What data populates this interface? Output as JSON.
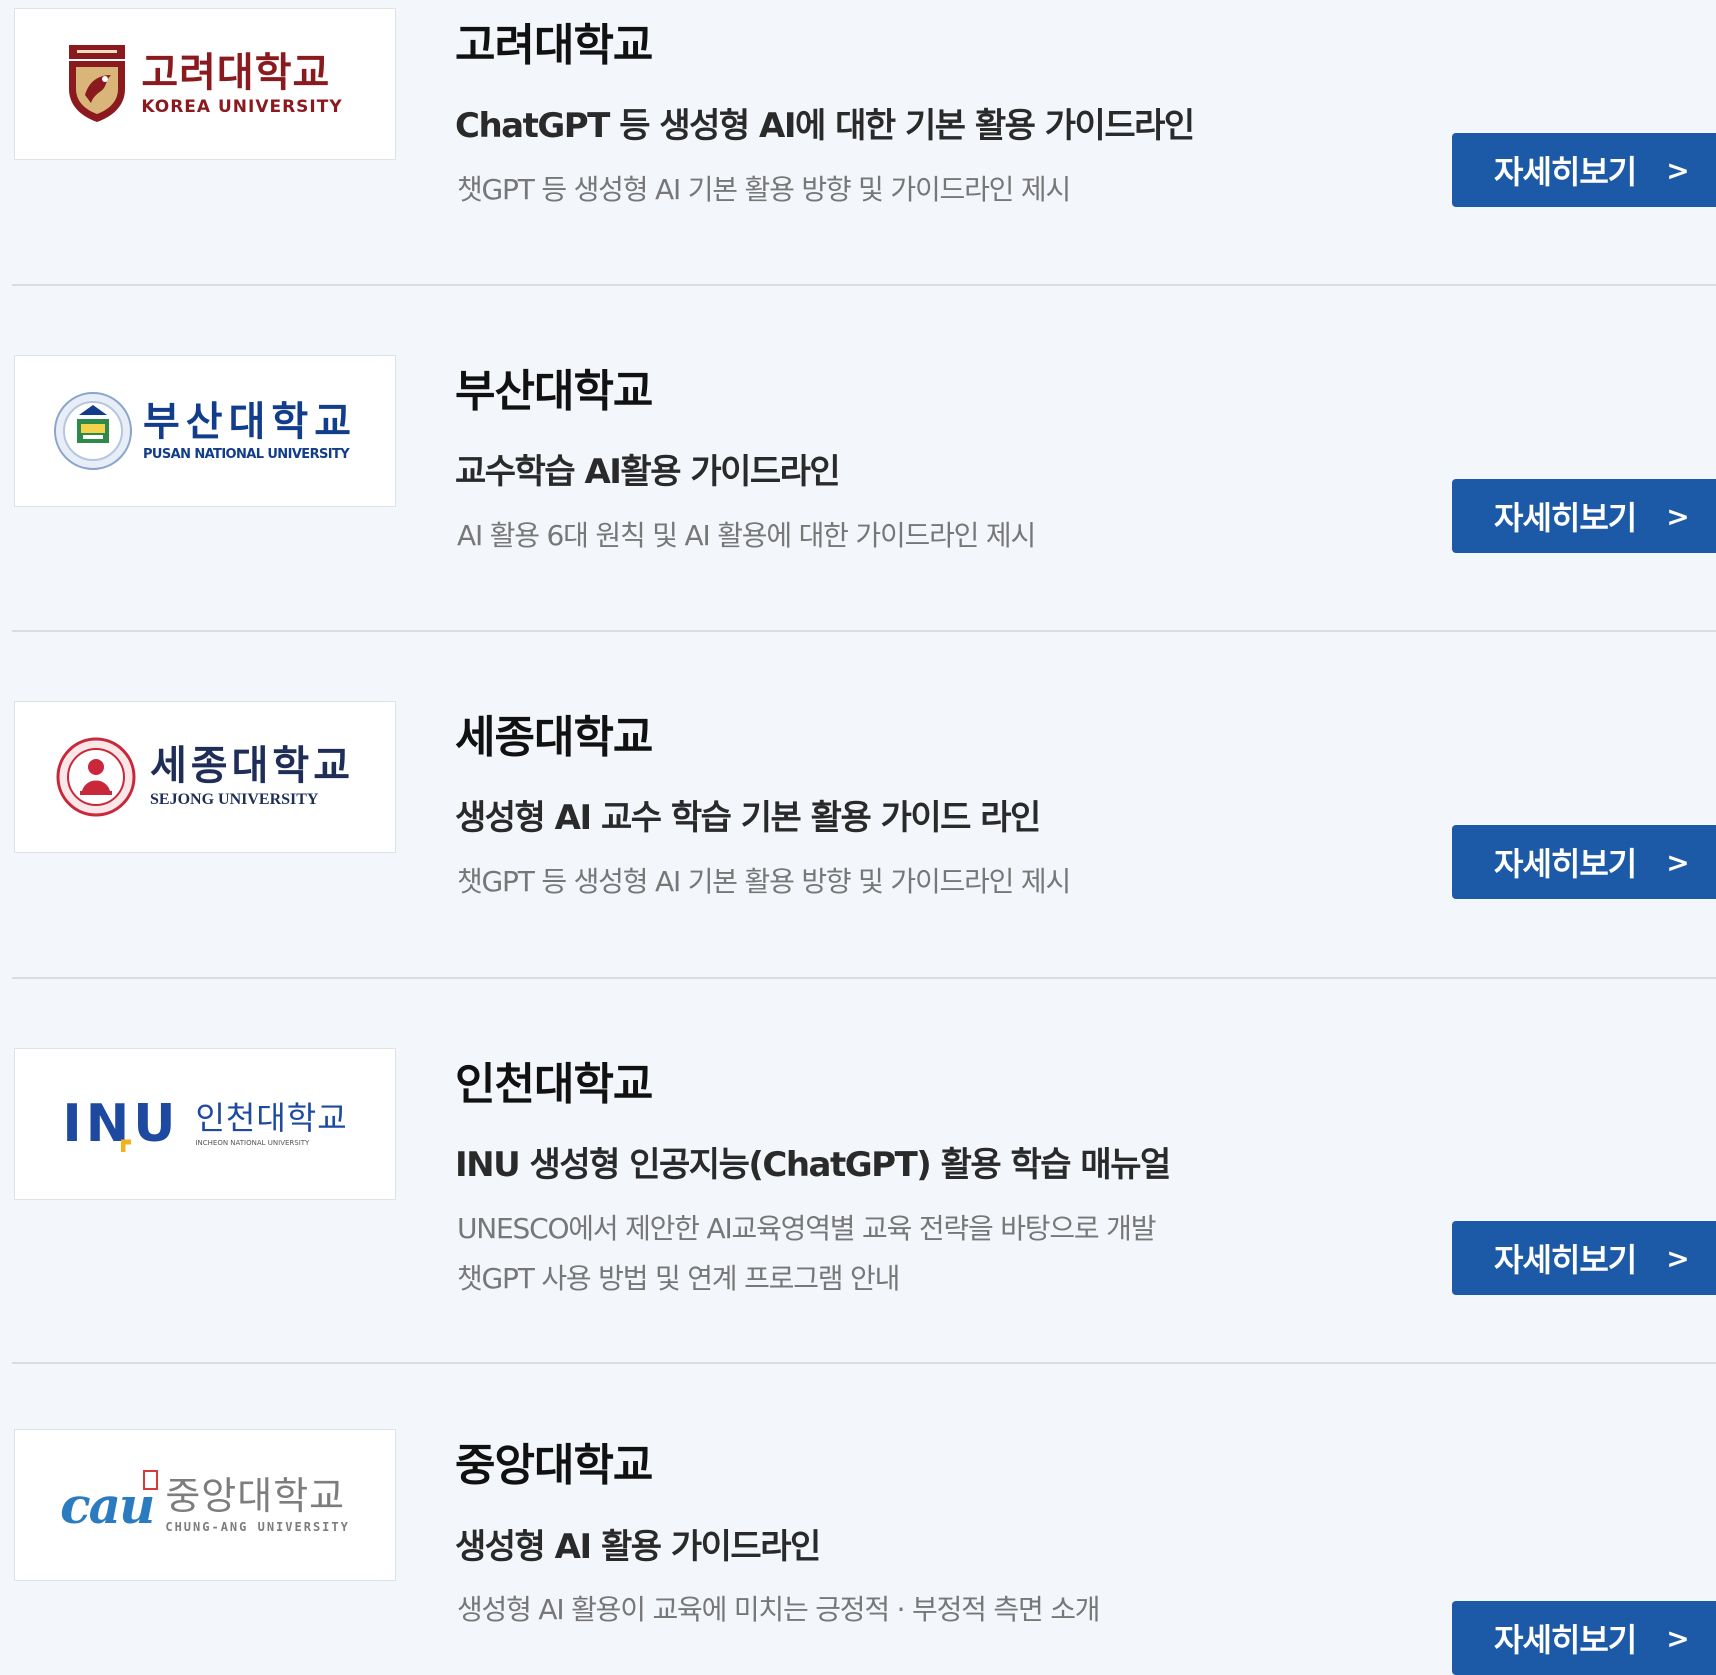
{
  "colors": {
    "background": "#f3f7fc",
    "button": "#1c5aa8",
    "korea_red": "#8b1a1f",
    "pusan_blue": "#123d8c",
    "sejong_red": "#c8283a",
    "inu_blue": "#1d4aa0",
    "inu_yellow": "#f2b21b",
    "cau_blue": "#2a7bc0",
    "cau_gray": "#7d7d7d"
  },
  "detail_button": {
    "label": "자세히보기",
    "chevron": ">"
  },
  "universities": [
    {
      "logo": {
        "korean": "고려대학교",
        "english": "KOREA UNIVERSITY",
        "icon": "korea-university-crest-icon"
      },
      "name": "고려대학교",
      "guide_title": "ChatGPT 등 생성형 AI에 대한 기본 활용 가이드라인",
      "description": [
        "챗GPT 등 생성형 AI 기본 활용 방향 및 가이드라인 제시"
      ]
    },
    {
      "logo": {
        "korean": "부산대학교",
        "english": "PUSAN NATIONAL UNIVERSITY",
        "icon": "pusan-university-emblem-icon"
      },
      "name": "부산대학교",
      "guide_title": "교수학습 AI활용 가이드라인",
      "description": [
        "AI 활용 6대 원칙 및 AI 활용에 대한 가이드라인 제시"
      ]
    },
    {
      "logo": {
        "korean": "세종대학교",
        "english": "SEJONG UNIVERSITY",
        "icon": "sejong-university-seal-icon"
      },
      "name": "세종대학교",
      "guide_title": "생성형 AI 교수 학습 기본 활용 가이드 라인",
      "description": [
        "챗GPT 등 생성형 AI 기본 활용 방향 및 가이드라인 제시"
      ]
    },
    {
      "logo": {
        "symbol": "INU",
        "korean": "인천대학교",
        "english": "INCHEON NATIONAL UNIVERSITY",
        "icon": "inu-logo-icon"
      },
      "name": "인천대학교",
      "guide_title": "INU 생성형 인공지능(ChatGPT) 활용 학습 매뉴얼",
      "description": [
        "UNESCO에서 제안한 AI교육영역별 교육 전략을 바탕으로 개발",
        "챗GPT 사용 방법 및 연계 프로그램 안내"
      ]
    },
    {
      "logo": {
        "symbol": "cau",
        "korean": "중앙대학교",
        "english": "CHUNG-ANG UNIVERSITY",
        "icon": "cau-logo-icon"
      },
      "name": "중앙대학교",
      "guide_title": "생성형 AI 활용 가이드라인",
      "description": [
        "생성형 AI 활용이 교육에 미치는 긍정적 · 부정적 측면 소개"
      ]
    }
  ]
}
